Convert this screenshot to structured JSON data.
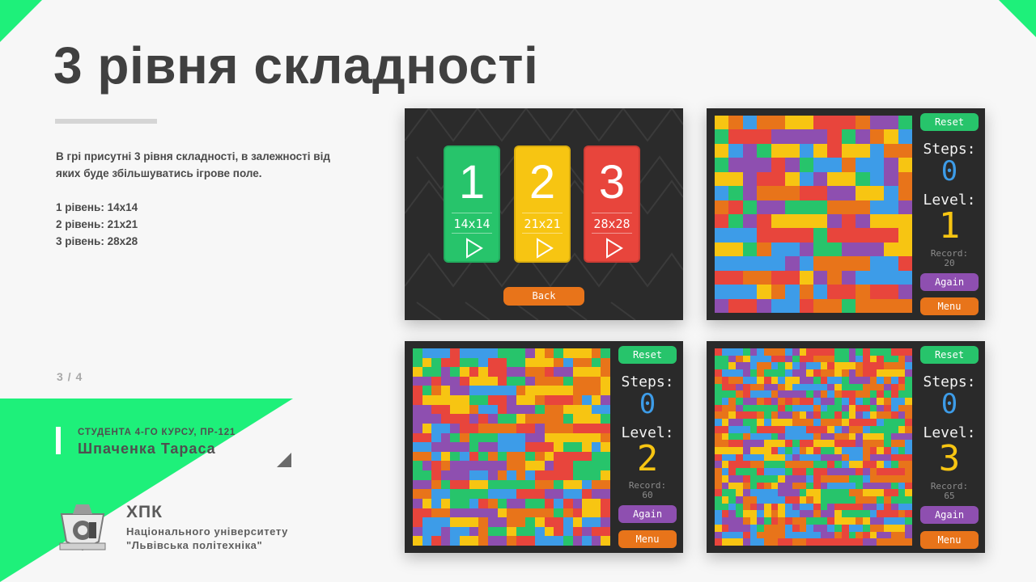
{
  "slide": {
    "title": "3 рівня складності",
    "description": "В грі присутні 3 рівня складності, в залежності від яких буде збільшуватись ігрове поле.",
    "levels": [
      "1 рівень: 14x14",
      "2 рівень: 21x21",
      "3 рівень: 28x28"
    ],
    "page_number": "3 / 4",
    "author_role": "СТУДЕНТА 4-ГО КУРСУ, ПР-121",
    "author_name": "Шпаченка Тараса",
    "university_abbr": "ХПК",
    "university_line1": "Національного університету",
    "university_line2": "\"Львівська політехніка\""
  },
  "colors": {
    "accent": "#1ef07a",
    "palette": [
      "#e8453c",
      "#f7c512",
      "#27c46b",
      "#3d9ce8",
      "#8e4fb0",
      "#e8741a"
    ]
  },
  "menu_screen": {
    "cards": [
      {
        "number": "1",
        "size": "14x14",
        "color": "#27c46b"
      },
      {
        "number": "2",
        "size": "21x21",
        "color": "#f7c512"
      },
      {
        "number": "3",
        "size": "28x28",
        "color": "#e8453c"
      }
    ],
    "back_label": "Back"
  },
  "game_screens": [
    {
      "grid": 14,
      "reset_label": "Reset",
      "steps_label": "Steps:",
      "steps": "0",
      "level_label": "Level:",
      "level": "1",
      "record_label": "Record:",
      "record": "20",
      "again_label": "Again",
      "menu_label": "Menu"
    },
    {
      "grid": 21,
      "reset_label": "Reset",
      "steps_label": "Steps:",
      "steps": "0",
      "level_label": "Level:",
      "level": "2",
      "record_label": "Record:",
      "record": "60",
      "again_label": "Again",
      "menu_label": "Menu"
    },
    {
      "grid": 28,
      "reset_label": "Reset",
      "steps_label": "Steps:",
      "steps": "0",
      "level_label": "Level:",
      "level": "3",
      "record_label": "Record:",
      "record": "65",
      "again_label": "Again",
      "menu_label": "Menu"
    }
  ]
}
